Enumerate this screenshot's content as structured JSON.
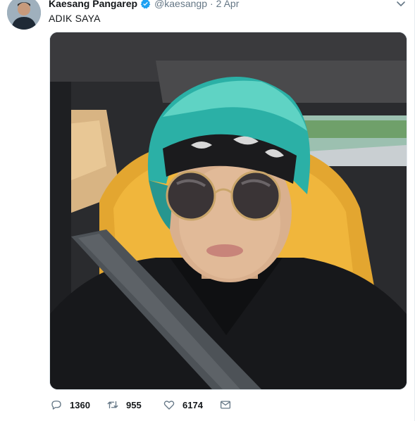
{
  "tweet": {
    "author_name": "Kaesang Pangarep",
    "handle": "@kaesangp",
    "separator": "·",
    "date": "2 Apr",
    "text": "ADIK SAYA",
    "media_icon": "selfie-photo",
    "verified_color": "#1da1f2"
  },
  "actions": {
    "reply_count": "1360",
    "retweet_count": "955",
    "like_count": "6174",
    "icons": [
      "reply-icon",
      "retweet-icon",
      "like-icon",
      "message-icon"
    ]
  }
}
